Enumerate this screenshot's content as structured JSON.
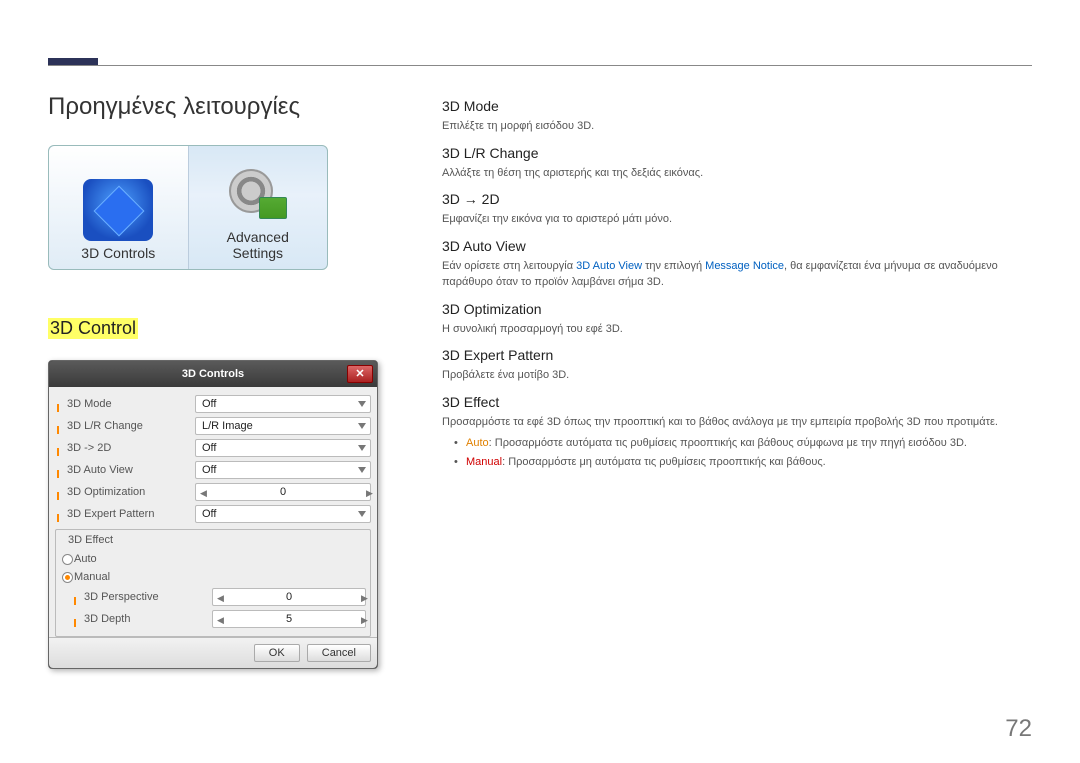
{
  "page_title": "Προηγμένες λειτουργίες",
  "ctrlsel": {
    "left_label": "3D Controls",
    "right_label_line1": "Advanced",
    "right_label_line2": "Settings"
  },
  "section_highlight": "3D Control",
  "dialog": {
    "title": "3D Controls",
    "close": "✕",
    "rows": [
      {
        "label": "3D Mode",
        "value": "Off"
      },
      {
        "label": "3D L/R Change",
        "value": "L/R Image"
      },
      {
        "label": "3D -> 2D",
        "value": "Off"
      },
      {
        "label": "3D Auto View",
        "value": "Off"
      },
      {
        "label": "3D Optimization",
        "value": "0"
      },
      {
        "label": "3D Expert Pattern",
        "value": "Off"
      }
    ],
    "group_title": "3D Effect",
    "radio_auto": "Auto",
    "radio_manual": "Manual",
    "subrows": [
      {
        "label": "3D Perspective",
        "value": "0"
      },
      {
        "label": "3D Depth",
        "value": "5"
      }
    ],
    "ok": "OK",
    "cancel": "Cancel"
  },
  "right": {
    "mode_title": "3D Mode",
    "mode_text": "Επιλέξτε τη μορφή εισόδου 3D.",
    "lr_title": "3D L/R Change",
    "lr_text": "Αλλάξτε τη θέση της αριστερής και της δεξιάς εικόνας.",
    "to2d_title": "3D → 2D",
    "to2d_text": "Εμφανίζει την εικόνα για το αριστερό μάτι μόνο.",
    "auto_title": "3D Auto View",
    "auto_text_pre": "Εάν ορίσετε στη λειτουργία ",
    "auto_text_link1": "3D Auto View",
    "auto_text_mid": " την επιλογή ",
    "auto_text_link2": "Message Notice",
    "auto_text_post": ", θα εμφανίζεται ένα μήνυμα σε αναδυόμενο παράθυρο όταν το προϊόν λαμβάνει σήμα 3D.",
    "opt_title": "3D Optimization",
    "opt_text": "Η συνολική προσαρμογή του εφέ 3D.",
    "pat_title": "3D Expert Pattern",
    "pat_text": "Προβάλετε ένα μοτίβο 3D.",
    "eff_title": "3D Effect",
    "eff_text": "Προσαρμόστε τα εφέ 3D όπως την προοπτική και το βάθος ανάλογα με την εμπειρία προβολής 3D που προτιμάτε.",
    "bullet1_key": "Auto",
    "bullet1_rest": ": Προσαρμόστε αυτόματα τις ρυθμίσεις προοπτικής και βάθους σύμφωνα με την πηγή εισόδου 3D.",
    "bullet2_key": "Manual",
    "bullet2_rest": ": Προσαρμόστε μη αυτόματα τις ρυθμίσεις προοπτικής και βάθους."
  },
  "page_number": "72"
}
